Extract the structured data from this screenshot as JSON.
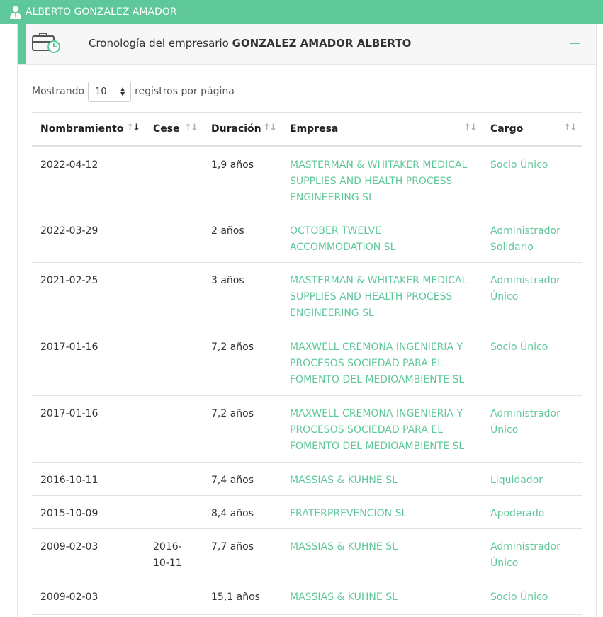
{
  "topbar": {
    "title": "ALBERTO GONZALEZ AMADOR",
    "icon": "user-icon"
  },
  "panel": {
    "header_prefix": "Cronología del empresario ",
    "header_name": "GONZALEZ AMADOR ALBERTO",
    "icon": "briefcase-clock-icon"
  },
  "length": {
    "before": "Mostrando",
    "value": "10",
    "after": "registros por página"
  },
  "columns": [
    "Nombramiento",
    "Cese",
    "Duración",
    "Empresa",
    "Cargo"
  ],
  "rows": [
    {
      "nombramiento": "2022-04-12",
      "cese": "",
      "duracion": "1,9 años",
      "empresa": "MASTERMAN & WHITAKER MEDICAL SUPPLIES AND HEALTH PROCESS ENGINEERING SL",
      "cargo": "Socio Único"
    },
    {
      "nombramiento": "2022-03-29",
      "cese": "",
      "duracion": "2 años",
      "empresa": "OCTOBER TWELVE ACCOMMODATION SL",
      "cargo": "Administrador Solidario"
    },
    {
      "nombramiento": "2021-02-25",
      "cese": "",
      "duracion": "3 años",
      "empresa": "MASTERMAN & WHITAKER MEDICAL SUPPLIES AND HEALTH PROCESS ENGINEERING SL",
      "cargo": "Administrador Único"
    },
    {
      "nombramiento": "2017-01-16",
      "cese": "",
      "duracion": "7,2 años",
      "empresa": "MAXWELL CREMONA INGENIERIA Y PROCESOS SOCIEDAD PARA EL FOMENTO DEL MEDIOAMBIENTE SL",
      "cargo": "Socio Único"
    },
    {
      "nombramiento": "2017-01-16",
      "cese": "",
      "duracion": "7,2 años",
      "empresa": "MAXWELL CREMONA INGENIERIA Y PROCESOS SOCIEDAD PARA EL FOMENTO DEL MEDIOAMBIENTE SL",
      "cargo": "Administrador Único"
    },
    {
      "nombramiento": "2016-10-11",
      "cese": "",
      "duracion": "7,4 años",
      "empresa": "MASSIAS & KUHNE SL",
      "cargo": "Liquidador"
    },
    {
      "nombramiento": "2015-10-09",
      "cese": "",
      "duracion": "8,4 años",
      "empresa": "FRATERPREVENCION SL",
      "cargo": "Apoderado"
    },
    {
      "nombramiento": "2009-02-03",
      "cese": "2016-10-11",
      "duracion": "7,7 años",
      "empresa": "MASSIAS & KUHNE SL",
      "cargo": "Administrador Único"
    },
    {
      "nombramiento": "2009-02-03",
      "cese": "",
      "duracion": "15,1 años",
      "empresa": "MASSIAS & KUHNE SL",
      "cargo": "Socio Único"
    }
  ]
}
